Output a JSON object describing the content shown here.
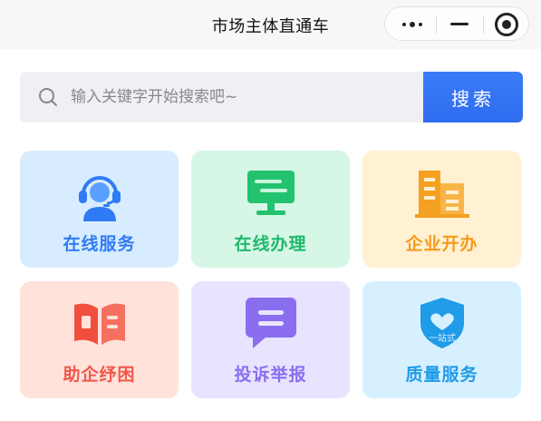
{
  "header": {
    "title": "市场主体直通车"
  },
  "search": {
    "placeholder": "输入关键字开始搜索吧~",
    "button_label": "搜索"
  },
  "services": [
    {
      "label": "在线服务",
      "icon": "customer-service-icon",
      "label_color": "#2f7bf5",
      "bg_color": "#d8ecff"
    },
    {
      "label": "在线办理",
      "icon": "monitor-icon",
      "label_color": "#1fb86a",
      "bg_color": "#d6f7e6"
    },
    {
      "label": "企业开办",
      "icon": "building-icon",
      "label_color": "#f59a1b",
      "bg_color": "#fff1d2"
    },
    {
      "label": "助企纾困",
      "icon": "open-book-icon",
      "label_color": "#f2584a",
      "bg_color": "#ffe2da"
    },
    {
      "label": "投诉举报",
      "icon": "message-icon",
      "label_color": "#8b6ef0",
      "bg_color": "#e8e4ff"
    },
    {
      "label": "质量服务",
      "icon": "quality-shield-icon",
      "shield_text": "一站式",
      "label_color": "#1f9be8",
      "bg_color": "#d7f0ff"
    }
  ]
}
